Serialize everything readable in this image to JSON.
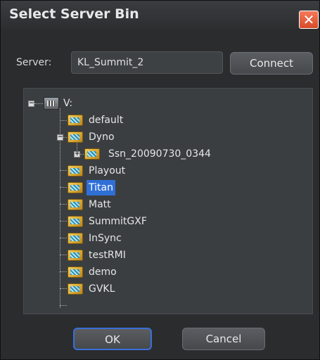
{
  "dialog": {
    "title": "Select Server Bin",
    "close_label": "✕"
  },
  "server": {
    "label": "Server:",
    "value": "KL_Summit_2",
    "connect_label": "Connect"
  },
  "tree": {
    "root": {
      "label": "V:",
      "icon": "drive-icon",
      "expander": "−"
    },
    "items": [
      {
        "label": "default",
        "icon": "folder-icon"
      },
      {
        "label": "Dyno",
        "icon": "folder-icon",
        "expander": "−"
      },
      {
        "label": "Ssn_20090730_0344",
        "icon": "folder-icon",
        "expander": "+"
      },
      {
        "label": "Playout",
        "icon": "folder-icon"
      },
      {
        "label": "Titan",
        "icon": "folder-icon",
        "selected": true
      },
      {
        "label": "Matt",
        "icon": "folder-icon"
      },
      {
        "label": "SummitGXF",
        "icon": "folder-icon"
      },
      {
        "label": "InSync",
        "icon": "folder-icon"
      },
      {
        "label": "testRMI",
        "icon": "folder-icon"
      },
      {
        "label": "demo",
        "icon": "folder-icon"
      },
      {
        "label": "GVKL",
        "icon": "folder-icon"
      }
    ]
  },
  "buttons": {
    "ok_label": "OK",
    "cancel_label": "Cancel"
  },
  "colors": {
    "selection": "#2f6fd6",
    "close_button": "#e05a3a",
    "dialog_background": "#2a2c2e"
  }
}
